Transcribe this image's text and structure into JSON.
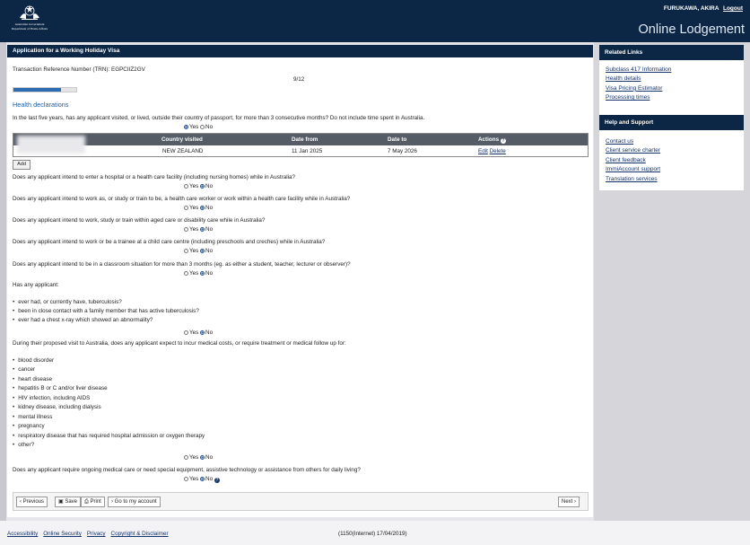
{
  "header": {
    "agency_line1": "Australian Government",
    "agency_line2": "Department of Home Affairs",
    "user_name": "FURUKAWA, AKIRA",
    "logout_label": "Logout",
    "app_title": "Online Lodgement"
  },
  "form": {
    "title": "Application for a Working Holiday Visa",
    "trn_label": "Transaction Reference Number (TRN): EGPCIIZ2GV",
    "page_indicator": "9/12",
    "progress_fraction": 0.75,
    "section_title": "Health declarations",
    "q_visited": "In the last five years, has any applicant visited, or lived, outside their country of passport, for more than 3 consecutive months? Do not include time spent in Australia.",
    "yes_label": "Yes",
    "no_label": "No",
    "table": {
      "headers": [
        "Country visited",
        "Date from",
        "Date to",
        "Actions"
      ],
      "rows": [
        {
          "country": "NEW ZEALAND",
          "date_from": "11 Jan 2025",
          "date_to": "7 May 2026",
          "edit": "Edit",
          "delete": "Delete"
        }
      ]
    },
    "add_label": "Add",
    "q_hospital": "Does any applicant intend to enter a hospital or a health care facility (including nursing homes) while in Australia?",
    "q_health_worker": "Does any applicant intend to work as, or study or train to be, a health care worker or work within a health care facility while in Australia?",
    "q_aged_care": "Does any applicant intend to work, study or train within aged care or disability care while in Australia?",
    "q_child_care": "Does any applicant intend to work or be a trainee at a child care centre (including preschools and creches) while in Australia?",
    "q_classroom": "Does any applicant intend to be in a classroom situation for more than 3 months (eg. as either a student, teacher, lecturer or observer)?",
    "q_tb_intro": "Has any applicant:",
    "tb_items": [
      "ever had, or currently have, tuberculosis?",
      "been in close contact with a family member that has active tuberculosis?",
      "ever had a chest x-ray which showed an abnormality?"
    ],
    "q_costs_intro": "During their proposed visit to Australia, does any applicant expect to incur medical costs, or require treatment or medical follow up for:",
    "cost_items": [
      "blood disorder",
      "cancer",
      "heart disease",
      "hepatitis B or C and/or liver disease",
      "HIV infection, including AIDS",
      "kidney disease, including dialysis",
      "mental illness",
      "pregnancy",
      "respiratory disease that has required hospital admission or oxygen therapy",
      "other?"
    ],
    "q_ongoing": "Does any applicant require ongoing medical care or need special equipment, assistive technology or assistance from others for daily living?"
  },
  "buttons": {
    "previous": "Previous",
    "save": "Save",
    "print": "Print",
    "goto_account": "Go to my account",
    "next": "Next"
  },
  "related_links": {
    "title": "Related Links",
    "items": [
      "Subclass 417 Information",
      "Health details",
      "Visa Pricing Estimator",
      "Processing times"
    ]
  },
  "help_support": {
    "title": "Help and Support",
    "items": [
      "Contact us",
      "Client service charter",
      "Client feedback",
      "ImmiAccount support",
      "Translation services"
    ]
  },
  "footer": {
    "links": [
      "Accessibility",
      "Online Security",
      "Privacy",
      "Copyright & Disclaimer"
    ],
    "build": "(1150(Internet) 17/04/2019)"
  },
  "colors": {
    "header_bg": "#0b2745",
    "accent": "#1f5fa8",
    "table_header": "#555c66"
  }
}
